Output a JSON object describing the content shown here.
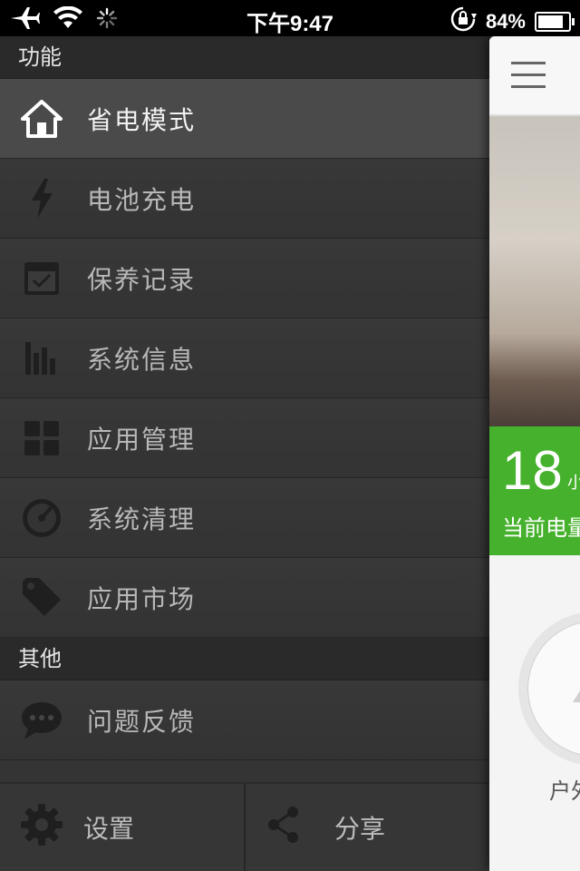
{
  "status_bar": {
    "time": "下午9:47",
    "battery": "84%",
    "battery_level": 0.84
  },
  "drawer": {
    "sections": [
      {
        "title": "功能",
        "items": [
          {
            "label": "省电模式",
            "icon": "home-icon",
            "active": true
          },
          {
            "label": "电池充电",
            "icon": "lightning-icon",
            "active": false
          },
          {
            "label": "保养记录",
            "icon": "calendar-check-icon",
            "active": false
          },
          {
            "label": "系统信息",
            "icon": "bar-chart-icon",
            "active": false
          },
          {
            "label": "应用管理",
            "icon": "grid-icon",
            "active": false
          },
          {
            "label": "系统清理",
            "icon": "speedometer-icon",
            "active": false
          },
          {
            "label": "应用市场",
            "icon": "tag-icon",
            "active": false
          }
        ]
      },
      {
        "title": "其他",
        "items": [
          {
            "label": "问题反馈",
            "icon": "chat-bubble-icon",
            "active": false
          }
        ]
      }
    ],
    "bottom": {
      "settings_label": "设置",
      "share_label": "分享"
    }
  },
  "main_panel": {
    "battery_hours": "18",
    "hours_unit": "小",
    "current_label": "当前电量",
    "caption": "户外"
  }
}
